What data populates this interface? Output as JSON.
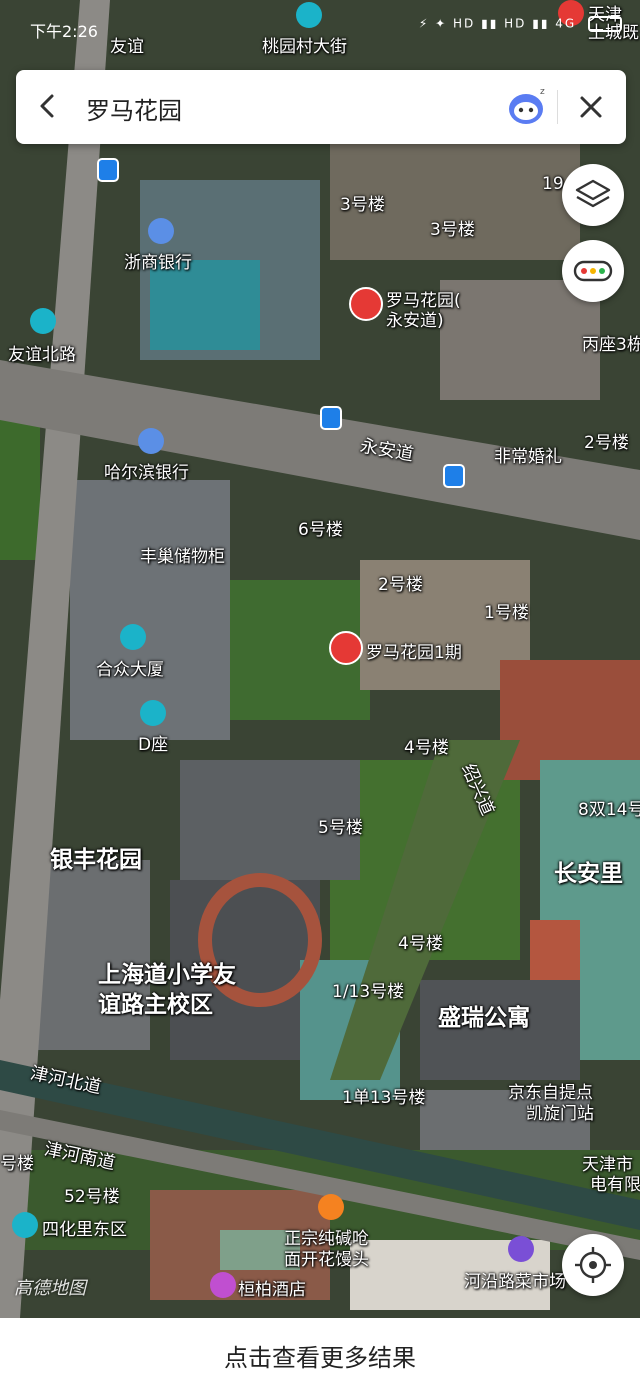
{
  "status_bar": {
    "time": "下午2:26",
    "right_indicators": "⚡ ✦ HD ▮▮ HD ▮▮ 4G"
  },
  "search": {
    "query": "罗马花园"
  },
  "map": {
    "watermark": "高德地图",
    "places": {
      "taoyuan": "桃园村大街",
      "you_short": "友谊",
      "tianjin_top": "天津",
      "tucheng": "土城既",
      "building3a": "3号楼",
      "building3b": "3号楼",
      "num19": "19",
      "zheshang": "浙商银行",
      "luoma_yonganline1": "罗马花园(",
      "luoma_yonganline2": "永安道)",
      "bingzuo": "丙座3栋",
      "youyibeilu": "友谊北路",
      "yongandao": "永安道",
      "building2_right": "2号楼",
      "haerbin": "哈尔滨银行",
      "feichanghunli": "非常婚礼",
      "building6": "6号楼",
      "fengchao": "丰巢储物柜",
      "building2": "2号楼",
      "building1": "1号楼",
      "hezhong": "合众大厦",
      "luoma1qi": "罗马花园1期",
      "building4": "4号楼",
      "shaoxingdao": "绍兴道",
      "dzuo": "D座",
      "shuang814": "8双14号",
      "building5": "5号楼",
      "yinfeng": "银丰花园",
      "changanli": "长安里",
      "building4b": "4号楼",
      "shanghaidao_line1": "上海道小学友",
      "shanghaidao_line2": "谊路主校区",
      "building1_13": "1/13号楼",
      "shengrui": "盛瑞公寓",
      "jinhebeidao": "津河北道",
      "building1dan13": "1单13号楼",
      "jingdong_line1": "京东自提点",
      "jingdong_line2": "凯旋门站",
      "haolou_left": "号楼",
      "jinhenandao": "津河南道",
      "building52": "52号楼",
      "tianjinshi_line1": "天津市",
      "tianjinshi_line2": "电有限",
      "sihuali": "四化里东区",
      "zhengzong_line1": "正宗纯碱呛",
      "zhengzong_line2": "面开花馒头",
      "heyan": "河沿路菜市场",
      "huanbo": "桓柏酒店"
    }
  },
  "icons": {
    "back": "back-arrow-icon",
    "mascot": "voice-assistant-icon",
    "close": "close-icon",
    "layers": "layers-icon",
    "traffic": "traffic-icon",
    "locate": "locate-icon"
  },
  "colors": {
    "poi_bank": "#5b8fe6",
    "poi_cyan": "#1bb3c9",
    "poi_pin": "#e53935",
    "bus": "#1e7fe8",
    "food": "#f58220",
    "hotel": "#c04fd0",
    "market": "#7a4fd6"
  },
  "bottom_bar": {
    "more_results": "点击查看更多结果"
  }
}
